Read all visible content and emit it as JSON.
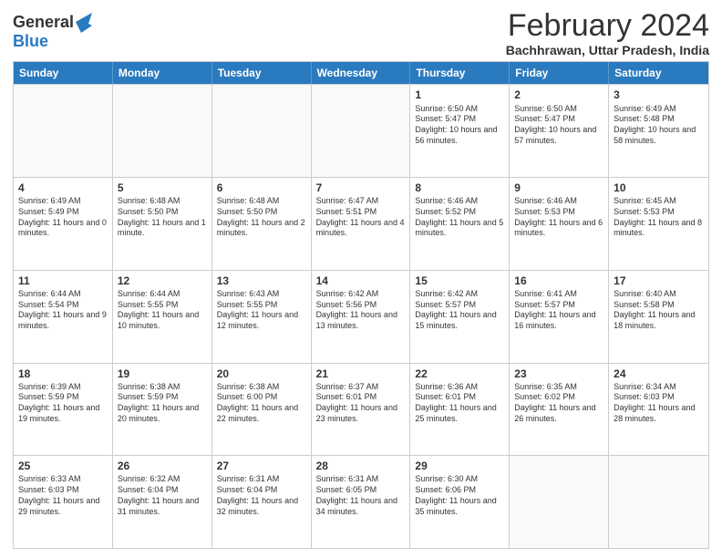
{
  "logo": {
    "general": "General",
    "blue": "Blue"
  },
  "header": {
    "title": "February 2024",
    "subtitle": "Bachhrawan, Uttar Pradesh, India"
  },
  "days": [
    "Sunday",
    "Monday",
    "Tuesday",
    "Wednesday",
    "Thursday",
    "Friday",
    "Saturday"
  ],
  "weeks": [
    [
      {
        "date": "",
        "empty": true
      },
      {
        "date": "",
        "empty": true
      },
      {
        "date": "",
        "empty": true
      },
      {
        "date": "",
        "empty": true
      },
      {
        "date": "1",
        "sunrise": "6:50 AM",
        "sunset": "5:47 PM",
        "daylight": "10 hours and 56 minutes."
      },
      {
        "date": "2",
        "sunrise": "6:50 AM",
        "sunset": "5:47 PM",
        "daylight": "10 hours and 57 minutes."
      },
      {
        "date": "3",
        "sunrise": "6:49 AM",
        "sunset": "5:48 PM",
        "daylight": "10 hours and 58 minutes."
      }
    ],
    [
      {
        "date": "4",
        "sunrise": "6:49 AM",
        "sunset": "5:49 PM",
        "daylight": "11 hours and 0 minutes."
      },
      {
        "date": "5",
        "sunrise": "6:48 AM",
        "sunset": "5:50 PM",
        "daylight": "11 hours and 1 minute."
      },
      {
        "date": "6",
        "sunrise": "6:48 AM",
        "sunset": "5:50 PM",
        "daylight": "11 hours and 2 minutes."
      },
      {
        "date": "7",
        "sunrise": "6:47 AM",
        "sunset": "5:51 PM",
        "daylight": "11 hours and 4 minutes."
      },
      {
        "date": "8",
        "sunrise": "6:46 AM",
        "sunset": "5:52 PM",
        "daylight": "11 hours and 5 minutes."
      },
      {
        "date": "9",
        "sunrise": "6:46 AM",
        "sunset": "5:53 PM",
        "daylight": "11 hours and 6 minutes."
      },
      {
        "date": "10",
        "sunrise": "6:45 AM",
        "sunset": "5:53 PM",
        "daylight": "11 hours and 8 minutes."
      }
    ],
    [
      {
        "date": "11",
        "sunrise": "6:44 AM",
        "sunset": "5:54 PM",
        "daylight": "11 hours and 9 minutes."
      },
      {
        "date": "12",
        "sunrise": "6:44 AM",
        "sunset": "5:55 PM",
        "daylight": "11 hours and 10 minutes."
      },
      {
        "date": "13",
        "sunrise": "6:43 AM",
        "sunset": "5:55 PM",
        "daylight": "11 hours and 12 minutes."
      },
      {
        "date": "14",
        "sunrise": "6:42 AM",
        "sunset": "5:56 PM",
        "daylight": "11 hours and 13 minutes."
      },
      {
        "date": "15",
        "sunrise": "6:42 AM",
        "sunset": "5:57 PM",
        "daylight": "11 hours and 15 minutes."
      },
      {
        "date": "16",
        "sunrise": "6:41 AM",
        "sunset": "5:57 PM",
        "daylight": "11 hours and 16 minutes."
      },
      {
        "date": "17",
        "sunrise": "6:40 AM",
        "sunset": "5:58 PM",
        "daylight": "11 hours and 18 minutes."
      }
    ],
    [
      {
        "date": "18",
        "sunrise": "6:39 AM",
        "sunset": "5:59 PM",
        "daylight": "11 hours and 19 minutes."
      },
      {
        "date": "19",
        "sunrise": "6:38 AM",
        "sunset": "5:59 PM",
        "daylight": "11 hours and 20 minutes."
      },
      {
        "date": "20",
        "sunrise": "6:38 AM",
        "sunset": "6:00 PM",
        "daylight": "11 hours and 22 minutes."
      },
      {
        "date": "21",
        "sunrise": "6:37 AM",
        "sunset": "6:01 PM",
        "daylight": "11 hours and 23 minutes."
      },
      {
        "date": "22",
        "sunrise": "6:36 AM",
        "sunset": "6:01 PM",
        "daylight": "11 hours and 25 minutes."
      },
      {
        "date": "23",
        "sunrise": "6:35 AM",
        "sunset": "6:02 PM",
        "daylight": "11 hours and 26 minutes."
      },
      {
        "date": "24",
        "sunrise": "6:34 AM",
        "sunset": "6:03 PM",
        "daylight": "11 hours and 28 minutes."
      }
    ],
    [
      {
        "date": "25",
        "sunrise": "6:33 AM",
        "sunset": "6:03 PM",
        "daylight": "11 hours and 29 minutes."
      },
      {
        "date": "26",
        "sunrise": "6:32 AM",
        "sunset": "6:04 PM",
        "daylight": "11 hours and 31 minutes."
      },
      {
        "date": "27",
        "sunrise": "6:31 AM",
        "sunset": "6:04 PM",
        "daylight": "11 hours and 32 minutes."
      },
      {
        "date": "28",
        "sunrise": "6:31 AM",
        "sunset": "6:05 PM",
        "daylight": "11 hours and 34 minutes."
      },
      {
        "date": "29",
        "sunrise": "6:30 AM",
        "sunset": "6:06 PM",
        "daylight": "11 hours and 35 minutes."
      },
      {
        "date": "",
        "empty": true
      },
      {
        "date": "",
        "empty": true
      }
    ]
  ]
}
